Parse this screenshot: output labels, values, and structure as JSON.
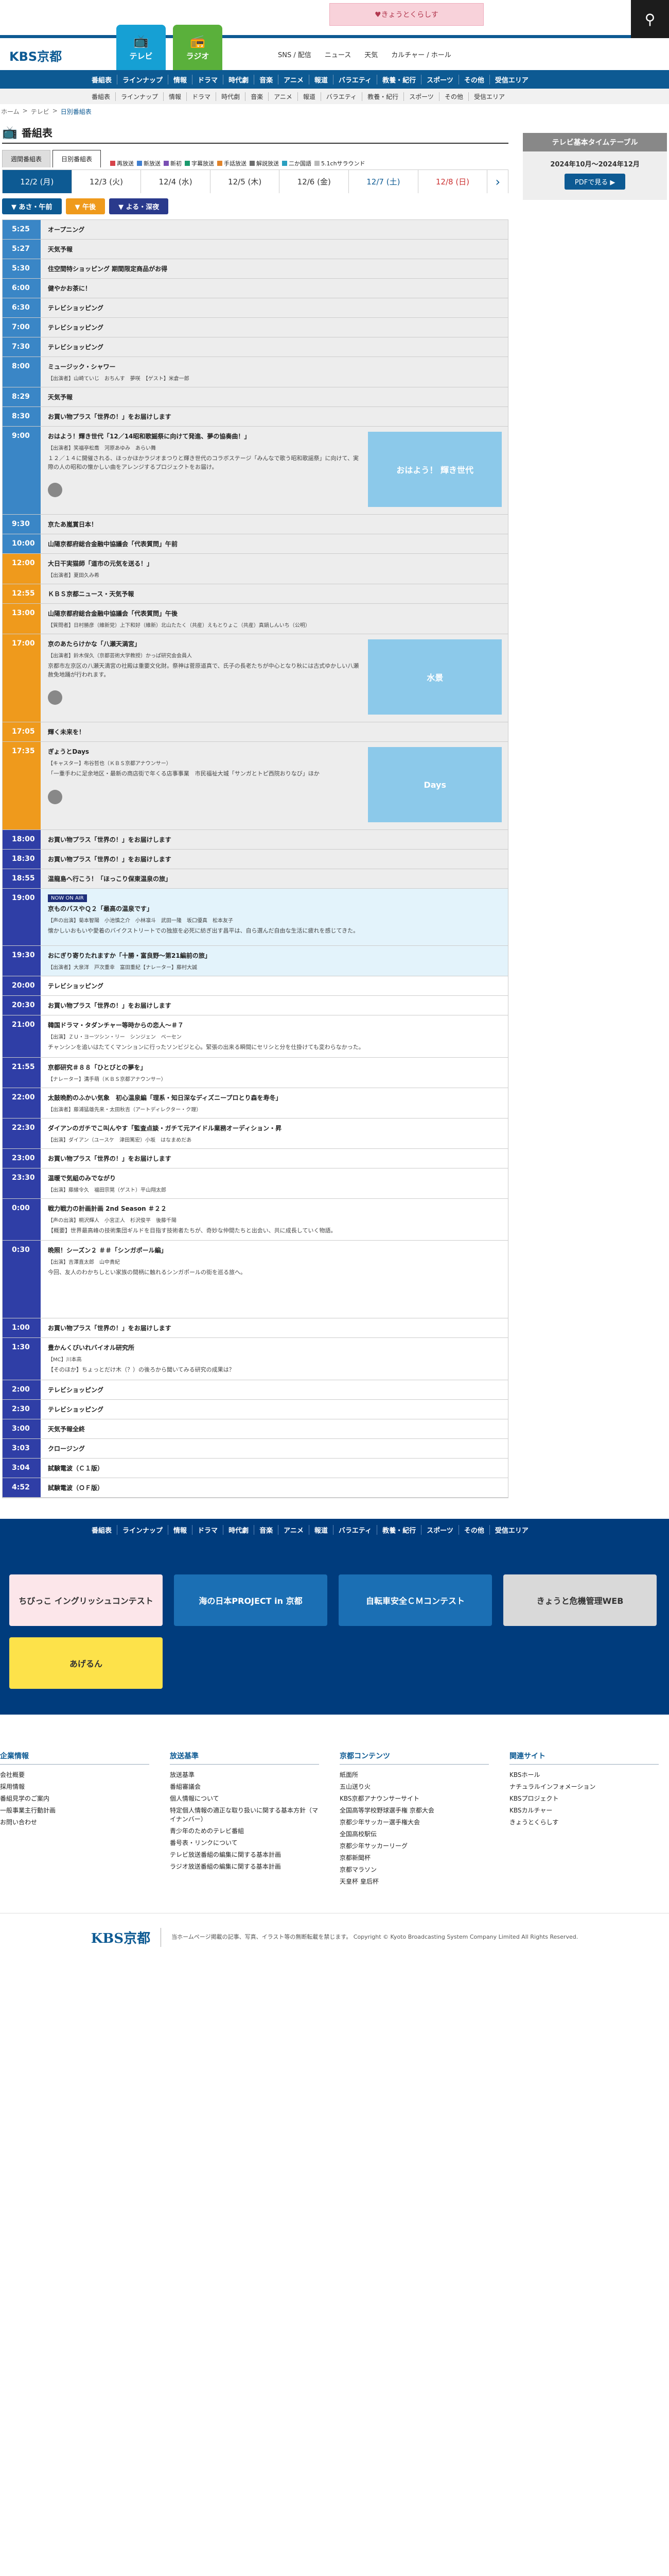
{
  "header": {
    "promo": "♥きょうとくらしす",
    "brand": "KBS京都",
    "tv_label": "テレビ",
    "radio_label": "ラジオ",
    "links": [
      "SNS / 配信",
      "ニュース",
      "天気",
      "カルチャー / ホール"
    ]
  },
  "mainnav": [
    "番組表",
    "ラインナップ",
    "情報",
    "ドラマ",
    "時代劇",
    "音楽",
    "アニメ",
    "報道",
    "バラエティ",
    "教養・紀行",
    "スポーツ",
    "その他",
    "受信エリア"
  ],
  "subnav": [
    "番組表",
    "ラインナップ",
    "情報",
    "ドラマ",
    "時代劇",
    "音楽",
    "アニメ",
    "報道",
    "バラエティ",
    "教養・紀行",
    "スポーツ",
    "その他",
    "受信エリア"
  ],
  "breadcrumb": {
    "home": "ホーム",
    "tv": "テレビ",
    "cur": "日別番組表"
  },
  "page_title": "番組表",
  "tabs": [
    "週間番組表",
    "日別番組表"
  ],
  "legend": [
    {
      "label": "再放送",
      "color": "#d6434a"
    },
    {
      "label": "新放送",
      "color": "#3f7fd1"
    },
    {
      "label": "新初",
      "color": "#7a4fb4"
    },
    {
      "label": "字幕放送",
      "color": "#1b9a6e"
    },
    {
      "label": "手話放送",
      "color": "#e0832a"
    },
    {
      "label": "解説放送",
      "color": "#6d6d6d"
    },
    {
      "label": "二か国語",
      "color": "#2a9fbf"
    },
    {
      "label": "5.1chサラウンド",
      "color": "#b9b9b9"
    }
  ],
  "dates": [
    "12/2 (月)",
    "12/3 (火)",
    "12/4 (水)",
    "12/5 (木)",
    "12/6 (金)",
    "12/7 (土)",
    "12/8 (日)"
  ],
  "periods": [
    "あさ・午前",
    "午後",
    "よる・深夜"
  ],
  "side": {
    "title": "テレビ基本タイムテーブル",
    "period": "2024年10月〜2024年12月",
    "pdf": "PDFで見る"
  },
  "schedule": [
    {
      "time": "5:25",
      "title": "オープニング",
      "band": "m"
    },
    {
      "time": "5:27",
      "title": "天気予報",
      "band": "m"
    },
    {
      "time": "5:30",
      "title": "住空間特ショッピング 期間限定商品がお得",
      "band": "m"
    },
    {
      "time": "6:00",
      "title": "健やかお茶に！",
      "band": "m"
    },
    {
      "time": "6:30",
      "title": "テレビショッピング",
      "band": "m"
    },
    {
      "time": "7:00",
      "title": "テレビショッピング",
      "band": "m"
    },
    {
      "time": "7:30",
      "title": "テレビショッピング",
      "band": "m"
    },
    {
      "time": "8:00",
      "title": "ミュージック・シャワー",
      "cast": "【出演者】山崎ていじ　おちんす　夢咲　【ゲスト】米倉一郎",
      "band": "m"
    },
    {
      "time": "8:29",
      "title": "天気予報",
      "band": "m"
    },
    {
      "time": "8:30",
      "title": "お買い物プラス「世界の！」をお届けします",
      "band": "m"
    },
    {
      "time": "9:00",
      "title": "おはよう！輝き世代「12／14昭和歌謡祭に向けて発進、夢の協奏曲！」",
      "cast": "【出演者】笑福亭松喬　河原あゆみ　あらい舞",
      "desc": "１２／１４に開催される、ほっかほかラジオまつりと輝き世代のコラボステージ「みんなで歌う昭和歌謡祭」に向けて、実際の人の昭和の懐かしい曲をアレンジするプロジェクトをお届け。",
      "thumb": "おはよう！ 輝き世代",
      "band": "m",
      "tall": true
    },
    {
      "time": "9:30",
      "title": "京たあ嵐賞日本！",
      "band": "m"
    },
    {
      "time": "10:00",
      "title": "山陽京都府総合金融中協議会「代表質問」午前",
      "band": "m"
    },
    {
      "time": "12:00",
      "title": "大日干実猫師「道市の元気を送る！」",
      "cast": "【出演者】夏田久み希",
      "band": "n"
    },
    {
      "time": "12:55",
      "title": "ＫＢＳ京都ニュース・天気予報",
      "band": "n"
    },
    {
      "time": "13:00",
      "title": "山陽京都府総合金融中協議会「代表質問」午後",
      "cast": "【質問者】日村勝彦（維新党）上下和好（維新）北山たたく（共産）えもとりょこ（共産）真鍋しんいち（公明）",
      "band": "n"
    },
    {
      "time": "17:00",
      "title": "京のあたらけかな「八瀬天満宮」",
      "cast": "【出演者】鈴木保久（京都芸術大学教授）かっぱ研究会会員人",
      "desc": "京都市左京区の八瀬天満宮の社殿は重要文化財。祭神は菅原道真で、氏子の長老たちが中心となり秋には古式ゆかしい八瀬赦免地踊が行われます。",
      "thumb": "水景",
      "band": "n",
      "tall": true
    },
    {
      "time": "17:05",
      "title": "輝く未来を！",
      "band": "n"
    },
    {
      "time": "17:35",
      "title": "ぎょうとDays",
      "cast": "【キャスター】布谷哲也（ＫＢＳ京都アナウンサー）",
      "desc": "「一重手わに足余地区・最新の商店街で年くる店事事業　市民福祉大城「サンガとトピ西院おりなび」ほか",
      "thumb": "Days",
      "band": "n",
      "tall": true
    },
    {
      "time": "18:00",
      "title": "お買い物プラス「世界の！」をお届けします",
      "band": "e"
    },
    {
      "time": "18:30",
      "title": "お買い物プラス「世界の！」をお届けします",
      "band": "e"
    },
    {
      "time": "18:55",
      "title": "温龍島へ行こう！「ほっこり保東温泉の旅」",
      "band": "e"
    },
    {
      "time": "19:00",
      "live": "NOW ON AIR",
      "title": "京ものバスやＱ２「最高の温泉です」",
      "cast": "【声の出演】菊本智陽　小池慎之介　小林凛斗　武田一隆　坂口優真　松本友子",
      "desc": "懐かしいおもいや愛着のバイクストリートでの独旅を必死に紡ぎ出す昌平は、自ら選んだ自由な生活に疲れを感じてきた。",
      "band": "e",
      "live_row": true
    },
    {
      "time": "19:30",
      "title": "おにぎり寄りたれますか「十勝・富良野〜第21編前の旅」",
      "cast": "【出演者】大泉洋　戸次重幸　富田重紀【ナレーター】藤村大誠",
      "band": "e",
      "light": true
    },
    {
      "time": "20:00",
      "title": "テレビショッピング",
      "band": "e",
      "white": true
    },
    {
      "time": "20:30",
      "title": "お買い物プラス「世界の！」をお届けします",
      "band": "e",
      "white": true
    },
    {
      "time": "21:00",
      "title": "韓国ドラマ・タダンチャー等時からの恋人〜＃７",
      "cast": "【出演】ＺＵ・ヨーツシン・リー　シンジェン　ベーセン",
      "desc": "チャンシンを追いはたてくマンションに行ったソンビジと心。緊張の出来る瞬間にセリシと分を仕掛けても変わらなかった。",
      "band": "e",
      "white": true
    },
    {
      "time": "21:55",
      "title": "京都研究＃８８「ひとびとの夢を」",
      "cast": "【ナレーター】溝手萌（ＫＢＳ京都アナウンサー）",
      "band": "e",
      "white": true
    },
    {
      "time": "22:00",
      "title": "太鼓晩酌のふかい気象　初心温泉編「理系・知日深なディズニープロとり森を寿冬」",
      "cast": "【出演者】藤浦猛雄先来・太田秋吉（アートディレクター・ク理）",
      "band": "e",
      "white": true
    },
    {
      "time": "22:30",
      "title": "ダイアンのガチでこ叫んやす「監査点談・ガチて元アイドル業務オーディション・昇",
      "cast": "【出演】ダイアン（ユースケ　津田篤宏）小坂　はなまめだあ",
      "band": "e",
      "white": true
    },
    {
      "time": "23:00",
      "title": "お買い物プラス「世界の！」をお届けします",
      "band": "e",
      "white": true
    },
    {
      "time": "23:30",
      "title": "温暖で気組のみでながり",
      "cast": "【出演】藤縁令久　福田宗晃（ゲスト）平山翔太郎",
      "band": "e",
      "white": true
    },
    {
      "time": "0:00",
      "title": "戦力戦力の計画計画 2nd Season ＃２２",
      "cast": "【声の出演】桐沢輝人　小宮正人　杉沢俊平　後藤千陽",
      "desc": "【概要】世界最高峰の技術集団ギルドを目指す技術者たちが、奇妙な仲間たちと出会い、共に成長していく物語。",
      "band": "e",
      "white": true
    },
    {
      "time": "0:30",
      "title": "晩照！シーズン２ ＃＃「シンガポール編」",
      "cast": "【出演】吉澤直太郎　山中貴紀",
      "desc": "今回、友人のわかちしとい家族の間柄に触れるシンガポールの街を巡る旅へ。",
      "band": "e",
      "white": true,
      "tall2": true
    },
    {
      "time": "1:00",
      "title": "お買い物プラス「世界の！」をお届けします",
      "band": "e",
      "white": true
    },
    {
      "time": "1:30",
      "title": "豊かんくびいれバイオル研究所",
      "cast": "【MC】川本高",
      "desc": "【そのほか】ちょっとだけ木（？）の後ろから聞いてみる研究の成果は？",
      "band": "e",
      "white": true
    },
    {
      "time": "2:00",
      "title": "テレビショッピング",
      "band": "e",
      "white": true
    },
    {
      "time": "2:30",
      "title": "テレビショッピング",
      "band": "e",
      "white": true
    },
    {
      "time": "3:00",
      "title": "天気予報全終",
      "band": "e",
      "white": true
    },
    {
      "time": "3:03",
      "title": "クロージング",
      "band": "e",
      "white": true
    },
    {
      "time": "3:04",
      "title": "試験電波（Ｃ１版）",
      "band": "e",
      "white": true
    },
    {
      "time": "4:52",
      "title": "試験電波（ＯＦ版）",
      "band": "e",
      "white": true
    }
  ],
  "banners": [
    {
      "label": "ちびっこ イングリッシュコンテスト",
      "bg": "#fce6ea"
    },
    {
      "label": "海の日本PROJECT in 京都",
      "bg": "#1b6fb4"
    },
    {
      "label": "自転車安全ＣＭコンテスト",
      "bg": "#1b6fb4"
    },
    {
      "label": "きょうと危機管理WEB",
      "bg": "#d9d9d9"
    },
    {
      "label": "あげるん",
      "bg": "#fde24a"
    }
  ],
  "footer": {
    "cols": [
      {
        "title": "企業情報",
        "items": [
          "会社概要",
          "採用情報",
          "番組見学のご案内",
          "一般事業主行動計画",
          "お問い合わせ"
        ]
      },
      {
        "title": "放送基準",
        "items": [
          "放送基準",
          "番組審議会",
          "個人情報について",
          "特定個人情報の適正な取り扱いに関する基本方針（マイナンバー）",
          "青少年のためのテレビ番組",
          "番号表・リンクについて",
          "テレビ放送番組の編集に関する基本計画",
          "ラジオ放送番組の編集に関する基本計画"
        ]
      },
      {
        "title": "京都コンテンツ",
        "items": [
          "紙面所",
          "五山送り火",
          "KBS京都アナウンサーサイト",
          "全国高等学校野球選手権 京都大会",
          "京都少年サッカー選手権大会",
          "全国高校駅伝",
          "京都少年サッカーリーグ",
          "京都新聞杯",
          "京都マラソン",
          "天皇杯 皇后杯"
        ]
      },
      {
        "title": "関連サイト",
        "items": [
          "KBSホール",
          "ナチュラルインフォメーション",
          "KBSプロジェクト",
          "KBSカルチャー",
          "きょうとくらしす"
        ]
      }
    ],
    "brand": "KBS京都",
    "copyright": "当ホームページ掲載の記事、写真、イラスト等の無断転載を禁じます。 Copyright © Kyoto Broadcasting System Company Limited All Rights Reserved."
  }
}
